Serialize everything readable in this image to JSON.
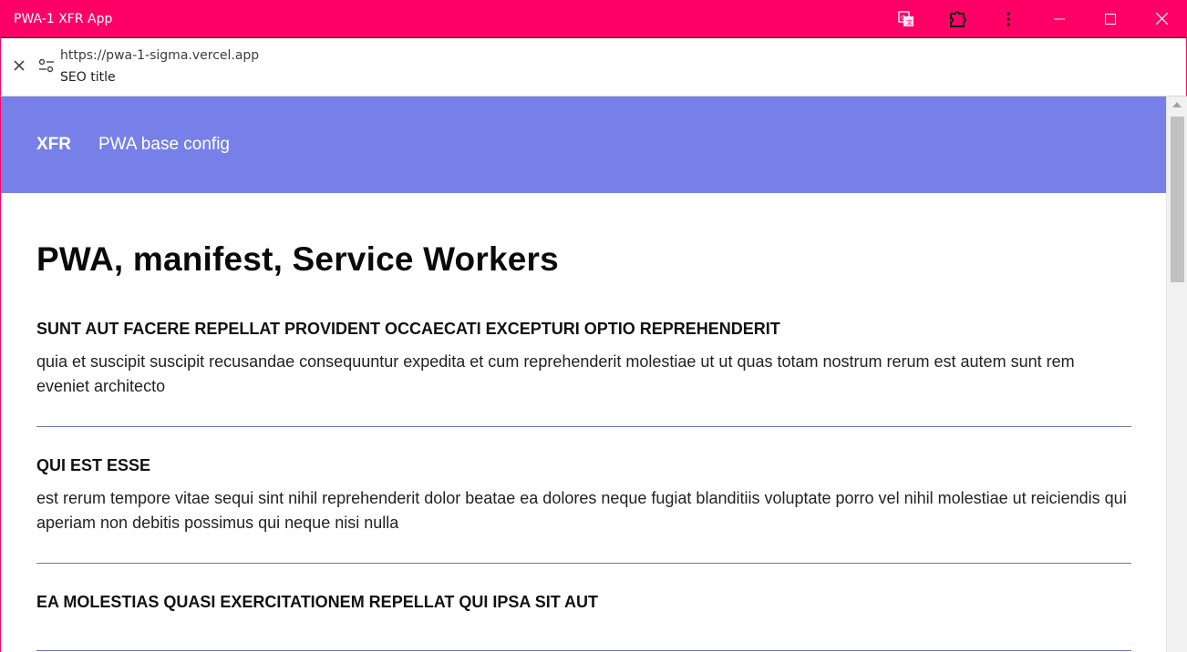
{
  "window": {
    "title": "PWA-1 XFR App",
    "accent": "#ff0066"
  },
  "titlebar_icons": [
    "translate-icon",
    "extension-icon",
    "more-options-icon",
    "minimize-icon",
    "maximize-icon",
    "close-icon"
  ],
  "address": {
    "url": "https://pwa-1-sigma.vercel.app",
    "page_title": "SEO title"
  },
  "site": {
    "header_color": "#7780e8",
    "logo": "XFR",
    "nav_link": "PWA base config"
  },
  "main": {
    "heading": "PWA, manifest, Service Workers",
    "posts": [
      {
        "title": "SUNT AUT FACERE REPELLAT PROVIDENT OCCAECATI EXCEPTURI OPTIO REPREHENDERIT",
        "body": "quia et suscipit suscipit recusandae consequuntur expedita et cum reprehenderit molestiae ut ut quas totam nostrum rerum est autem sunt rem eveniet architecto"
      },
      {
        "title": "QUI EST ESSE",
        "body": "est rerum tempore vitae sequi sint nihil reprehenderit dolor beatae ea dolores neque fugiat blanditiis voluptate porro vel nihil molestiae ut reiciendis qui aperiam non debitis possimus qui neque nisi nulla"
      },
      {
        "title": "EA MOLESTIAS QUASI EXERCITATIONEM REPELLAT QUI IPSA SIT AUT",
        "body": ""
      }
    ]
  }
}
